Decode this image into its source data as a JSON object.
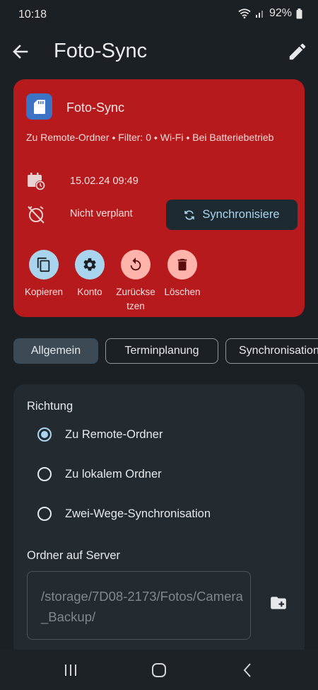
{
  "status": {
    "time": "10:18",
    "battery": "92%"
  },
  "app_bar": {
    "title": "Foto-Sync"
  },
  "card": {
    "name": "Foto-Sync",
    "description": "Zu Remote-Ordner ⬩ Filter: 0 ⬩ Wi-Fi ⬩ Bei Batteriebetrieb",
    "last_sync": "15.02.24 09:49",
    "schedule": "Nicht verplant",
    "sync_button": "Synchronisiere",
    "background_color": "#b71a1c",
    "actions": [
      {
        "label": "Kopieren",
        "icon": "copy-icon"
      },
      {
        "label": "Konto",
        "icon": "gear-icon"
      },
      {
        "label": "Zurückse tzen",
        "icon": "reset-icon"
      },
      {
        "label": "Löschen",
        "icon": "trash-icon"
      }
    ]
  },
  "tabs": [
    {
      "label": "Allgemein",
      "selected": true
    },
    {
      "label": "Terminplanung",
      "selected": false
    },
    {
      "label": "Synchronisation",
      "selected": false
    }
  ],
  "general": {
    "direction_label": "Richtung",
    "options": [
      {
        "label": "Zu Remote-Ordner",
        "selected": true
      },
      {
        "label": "Zu lokalem Ordner",
        "selected": false
      },
      {
        "label": "Zwei-Wege-Synchronisation",
        "selected": false
      }
    ],
    "server_folder_label": "Ordner auf Server",
    "server_folder_value": "/storage/7D08-2173/Fotos/Camera_Backup/"
  },
  "colors": {
    "accent": "#a9d4ee",
    "background": "#1b2024",
    "panel": "#232b31"
  }
}
